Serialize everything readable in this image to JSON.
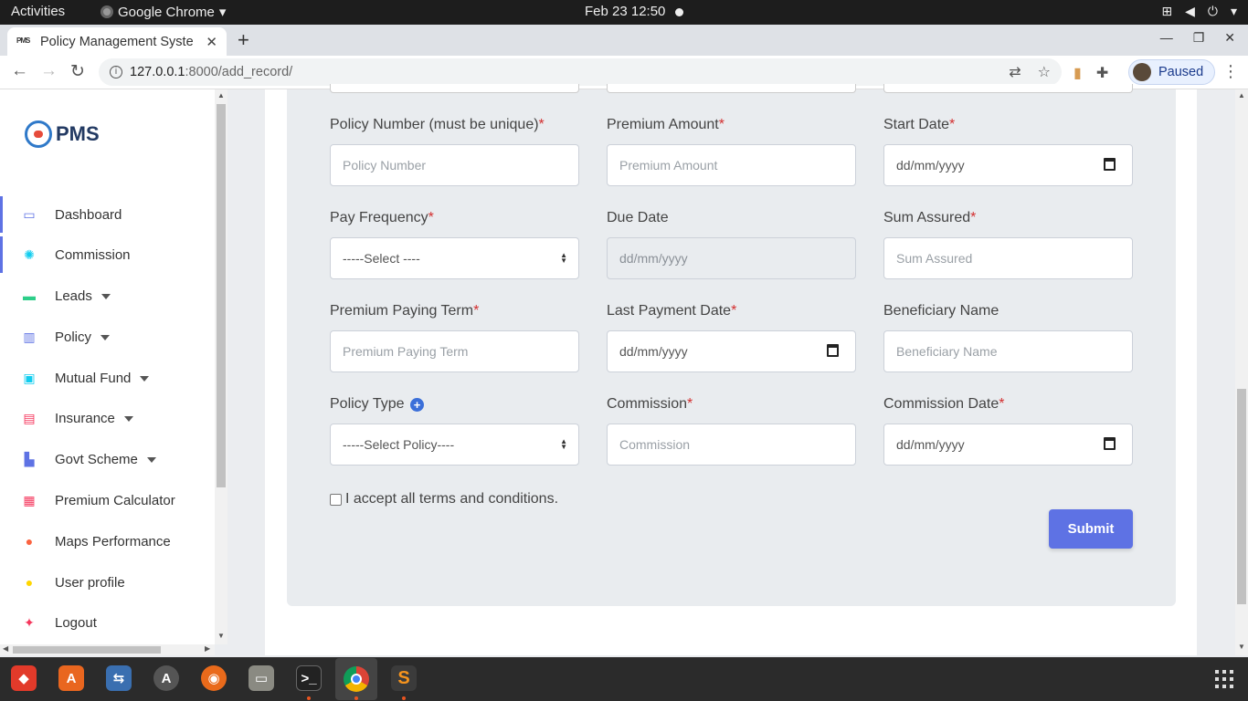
{
  "topbar": {
    "activities": "Activities",
    "app_name": "Google Chrome",
    "clock": "Feb 23  12:50"
  },
  "browser": {
    "tab_favicon_text": "PMS",
    "tab_title": "Policy Management Syste",
    "url_host": "127.0.0.1",
    "url_path": ":8000/add_record/",
    "profile_status": "Paused"
  },
  "sidebar": {
    "logo_text": "PMS",
    "items": [
      {
        "label": "Dashboard",
        "icon": "monitor-icon",
        "color": "#5e72e4",
        "dropdown": false
      },
      {
        "label": "Commission",
        "icon": "atom-icon",
        "color": "#11cdef",
        "dropdown": false
      },
      {
        "label": "Leads",
        "icon": "credit-card-icon",
        "color": "#2dce89",
        "dropdown": true
      },
      {
        "label": "Policy",
        "icon": "books-icon",
        "color": "#5e72e4",
        "dropdown": true
      },
      {
        "label": "Mutual Fund",
        "icon": "contact-icon",
        "color": "#11cdef",
        "dropdown": true
      },
      {
        "label": "Insurance",
        "icon": "document-icon",
        "color": "#f5365c",
        "dropdown": true
      },
      {
        "label": "Govt Scheme",
        "icon": "factory-icon",
        "color": "#5e72e4",
        "dropdown": true
      },
      {
        "label": "Premium Calculator",
        "icon": "calculator-icon",
        "color": "#f5365c",
        "dropdown": false
      },
      {
        "label": "Maps Performance",
        "icon": "map-pin-icon",
        "color": "#fb6340",
        "dropdown": false
      },
      {
        "label": "User profile",
        "icon": "user-icon",
        "color": "#ffd600",
        "dropdown": false
      },
      {
        "label": "Logout",
        "icon": "running-icon",
        "color": "#f5365c",
        "dropdown": false
      }
    ]
  },
  "form": {
    "fields": [
      {
        "label": "Policy Number (must be unique)",
        "required": true,
        "type": "text",
        "placeholder": "Policy Number"
      },
      {
        "label": "Premium Amount",
        "required": true,
        "type": "text",
        "placeholder": "Premium Amount"
      },
      {
        "label": "Start Date",
        "required": true,
        "type": "date",
        "placeholder": "dd/mm/yyyy"
      },
      {
        "label": "Pay Frequency",
        "required": true,
        "type": "select",
        "placeholder": "-----Select ----"
      },
      {
        "label": "Due Date",
        "required": false,
        "type": "disabled",
        "placeholder": "dd/mm/yyyy"
      },
      {
        "label": "Sum Assured",
        "required": true,
        "type": "text",
        "placeholder": "Sum Assured"
      },
      {
        "label": "Premium Paying Term",
        "required": true,
        "type": "text",
        "placeholder": "Premium Paying Term"
      },
      {
        "label": "Last Payment Date",
        "required": true,
        "type": "date",
        "placeholder": "dd/mm/yyyy"
      },
      {
        "label": "Beneficiary Name",
        "required": false,
        "type": "text",
        "placeholder": "Beneficiary Name"
      },
      {
        "label": "Policy Type",
        "required": false,
        "type": "select",
        "placeholder": "-----Select Policy----",
        "add_button": true
      },
      {
        "label": "Commission",
        "required": true,
        "type": "text",
        "placeholder": "Commission"
      },
      {
        "label": "Commission Date",
        "required": true,
        "type": "date",
        "placeholder": "dd/mm/yyyy"
      }
    ],
    "required_marker": "*",
    "terms_label": "I accept all terms and conditions.",
    "submit_label": "Submit"
  },
  "colors": {
    "accent": "#5e72e4",
    "required": "#d32f2f"
  }
}
